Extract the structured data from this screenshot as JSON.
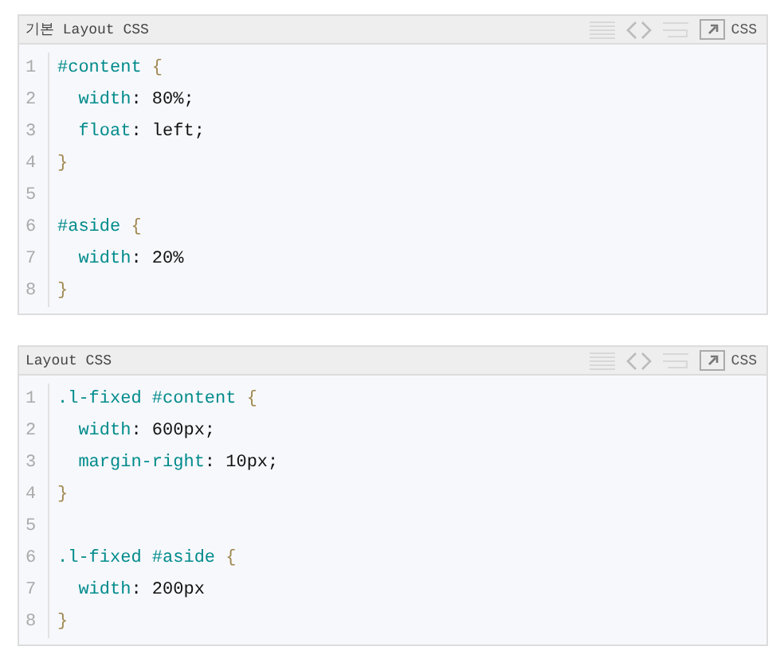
{
  "code_blocks": [
    {
      "title": "기본 Layout CSS",
      "language": "CSS",
      "lines": [
        {
          "number": "1",
          "tokens": [
            {
              "kind": "selector",
              "text": "#content"
            },
            {
              "kind": "punct",
              "text": " {"
            }
          ]
        },
        {
          "number": "2",
          "tokens": [
            {
              "kind": "property",
              "text": "  width"
            },
            {
              "kind": "value",
              "text": ": 80%;"
            }
          ]
        },
        {
          "number": "3",
          "tokens": [
            {
              "kind": "property",
              "text": "  float"
            },
            {
              "kind": "value",
              "text": ": left;"
            }
          ]
        },
        {
          "number": "4",
          "tokens": [
            {
              "kind": "punct",
              "text": "}"
            }
          ]
        },
        {
          "number": "5"
        },
        {
          "number": "6",
          "tokens": [
            {
              "kind": "selector",
              "text": "#aside"
            },
            {
              "kind": "punct",
              "text": " {"
            }
          ]
        },
        {
          "number": "7",
          "tokens": [
            {
              "kind": "property",
              "text": "  width"
            },
            {
              "kind": "value",
              "text": ": 20%"
            }
          ]
        },
        {
          "number": "8",
          "tokens": [
            {
              "kind": "punct",
              "text": "}"
            }
          ]
        }
      ]
    },
    {
      "title": "Layout CSS",
      "language": "CSS",
      "lines": [
        {
          "number": "1",
          "tokens": [
            {
              "kind": "selector",
              "text": ".l-fixed #content"
            },
            {
              "kind": "punct",
              "text": " {"
            }
          ]
        },
        {
          "number": "2",
          "tokens": [
            {
              "kind": "property",
              "text": "  width"
            },
            {
              "kind": "value",
              "text": ": 600px;"
            }
          ]
        },
        {
          "number": "3",
          "tokens": [
            {
              "kind": "property",
              "text": "  margin-right"
            },
            {
              "kind": "value",
              "text": ": 10px;"
            }
          ]
        },
        {
          "number": "4",
          "tokens": [
            {
              "kind": "punct",
              "text": "}"
            }
          ]
        },
        {
          "number": "5"
        },
        {
          "number": "6",
          "tokens": [
            {
              "kind": "selector",
              "text": ".l-fixed #aside"
            },
            {
              "kind": "punct",
              "text": " {"
            }
          ]
        },
        {
          "number": "7",
          "tokens": [
            {
              "kind": "property",
              "text": "  width"
            },
            {
              "kind": "value",
              "text": ": 200px"
            }
          ]
        },
        {
          "number": "8",
          "tokens": [
            {
              "kind": "punct",
              "text": "}"
            }
          ]
        }
      ]
    }
  ]
}
